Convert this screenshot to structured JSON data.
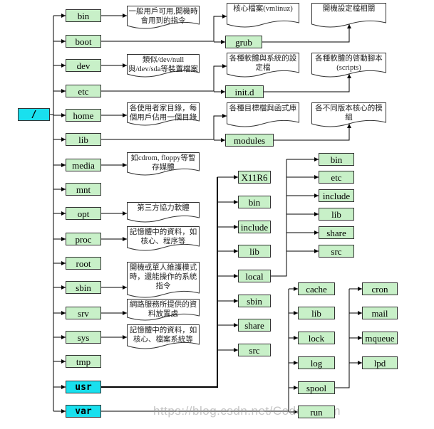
{
  "root": "/",
  "top_dirs": [
    "bin",
    "boot",
    "dev",
    "etc",
    "home",
    "lib",
    "media",
    "mnt",
    "opt",
    "proc",
    "root",
    "sbin",
    "srv",
    "sys",
    "tmp",
    "usr",
    "var"
  ],
  "highlight_dirs": [
    "usr",
    "var"
  ],
  "top_notes": {
    "bin": "一般用戶可用,開機時會用到的指令",
    "dev": "類似/dev/null與/dev/sda等裝置檔案",
    "home": "各使用者家目錄，每個用戶佔用一個目錄",
    "media": "如cdrom, floppy等暫存媒體",
    "opt": "第三方協力軟體",
    "proc": "記憶體中的資料，如核心、程序等",
    "sbin": "開機或單人維護模式時，還能操作的系統指令",
    "srv": "網路服務所提供的資料放置處",
    "sys": "記憶體中的資料，如核心、檔案系統等"
  },
  "sub": {
    "boot": {
      "dir": "grub",
      "note": "核心檔案(vmlinuz)",
      "dir_note": "開機設定檔相關"
    },
    "etc": {
      "dir": "init.d",
      "note": "各種軟體與系統的設定檔",
      "dir_note": "各種軟體的啓動腳本(scripts)"
    },
    "lib": {
      "dir": "modules",
      "note": "各種目標檔與函式庫",
      "dir_note": "各不同版本核心的模組"
    }
  },
  "usr_children": [
    "X11R6",
    "bin",
    "include",
    "lib",
    "local",
    "sbin",
    "share",
    "src"
  ],
  "local_children": [
    "bin",
    "etc",
    "include",
    "lib",
    "share",
    "src"
  ],
  "var_children": [
    "cache",
    "lib",
    "lock",
    "log",
    "spool",
    "run"
  ],
  "spool_children": [
    "cron",
    "mail",
    "mqueue",
    "lpd"
  ],
  "watermark": "https://blog.csdn.net/CoderBoom",
  "colors": {
    "dir": "#c8f0c8",
    "highlight": "#19e0ee",
    "line": "#000000"
  }
}
